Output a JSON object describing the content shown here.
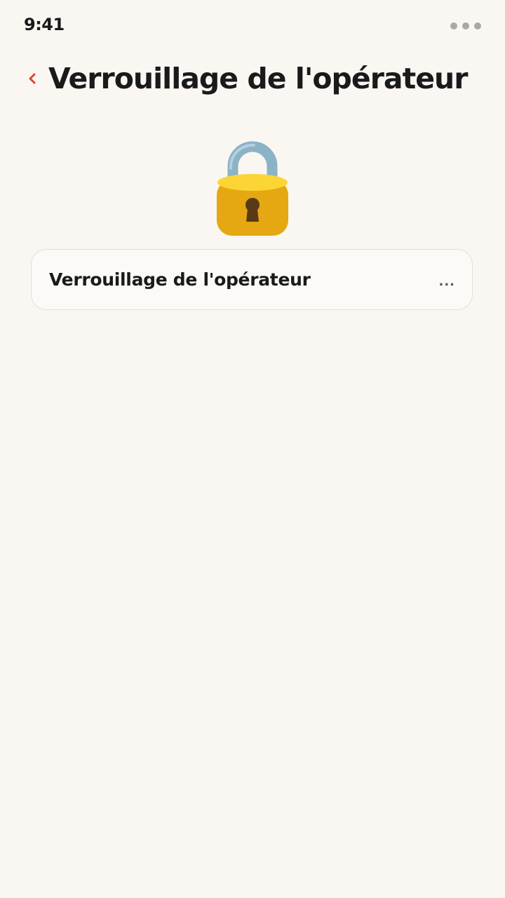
{
  "status_bar": {
    "time": "9:41",
    "menu_icon": "more-dots-icon"
  },
  "header": {
    "back_icon": "chevron-left-icon",
    "title": "Verrouillage de l'opérateur",
    "accent_color": "#e0452d"
  },
  "hero": {
    "icon": "padlock-icon"
  },
  "list": {
    "items": [
      {
        "label": "Verrouillage de l'opérateur",
        "more": "..."
      }
    ]
  },
  "colors": {
    "background": "#faf7f3",
    "card_background": "#fbfaf7",
    "card_border": "#e3dfda",
    "text": "#1a1a1a"
  }
}
